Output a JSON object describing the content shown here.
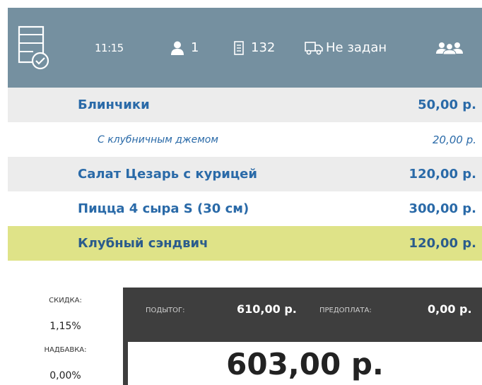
{
  "header": {
    "order_icon": "order-list-check-icon",
    "time": "11:15",
    "guests_icon": "person-icon",
    "guests": "1",
    "check_icon": "receipt-icon",
    "check_number": "132",
    "delivery_icon": "delivery-truck-icon",
    "delivery_status": "Не задан",
    "team_icon": "group-icon"
  },
  "items": [
    {
      "name": "Блинчики",
      "price": "50,00 р."
    },
    {
      "name": "С клубничным джемом",
      "price": "20,00 р."
    },
    {
      "name": "Салат Цезарь с курицей",
      "price": "120,00 р."
    },
    {
      "name": "Пицца 4 сыра S (30 см)",
      "price": "300,00 р."
    },
    {
      "name": "Клубный сэндвич",
      "price": "120,00 р."
    }
  ],
  "summary": {
    "discount_label": "СКИДКА:",
    "discount_value": "1,15%",
    "surcharge_label": "НАДБАВКА:",
    "surcharge_value": "0,00%",
    "subtotal_label": "ПОДЫТОГ:",
    "subtotal_value": "610,00 р.",
    "prepay_label": "ПРЕДОПЛАТА:",
    "prepay_value": "0,00 р.",
    "total": "603,00 р."
  },
  "colors": {
    "header_bg": "#7590a0",
    "item_text": "#2a6aa8",
    "selected_row": "#dfe388",
    "summary_bg": "#3e3e3e"
  }
}
